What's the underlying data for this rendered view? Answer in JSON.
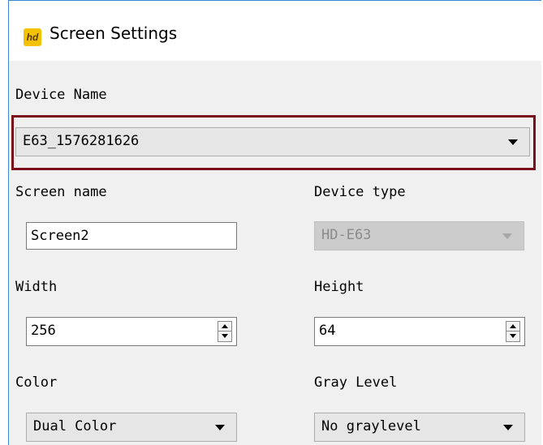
{
  "window": {
    "title": "Screen Settings",
    "icon": "app-logo-icon"
  },
  "device_name": {
    "label": "Device Name",
    "value": "E63_1576281626"
  },
  "screen_name": {
    "label": "Screen name",
    "value": "Screen2"
  },
  "device_type": {
    "label": "Device type",
    "value": "HD-E63"
  },
  "width": {
    "label": "Width",
    "value": "256"
  },
  "height": {
    "label": "Height",
    "value": "64"
  },
  "color": {
    "label": "Color",
    "value": "Dual Color"
  },
  "gray_level": {
    "label": "Gray Level",
    "value": "No graylevel"
  },
  "colors": {
    "highlight_border": "#7b0e1b",
    "window_border": "#3d86d6",
    "app_icon": "#f2c200"
  }
}
